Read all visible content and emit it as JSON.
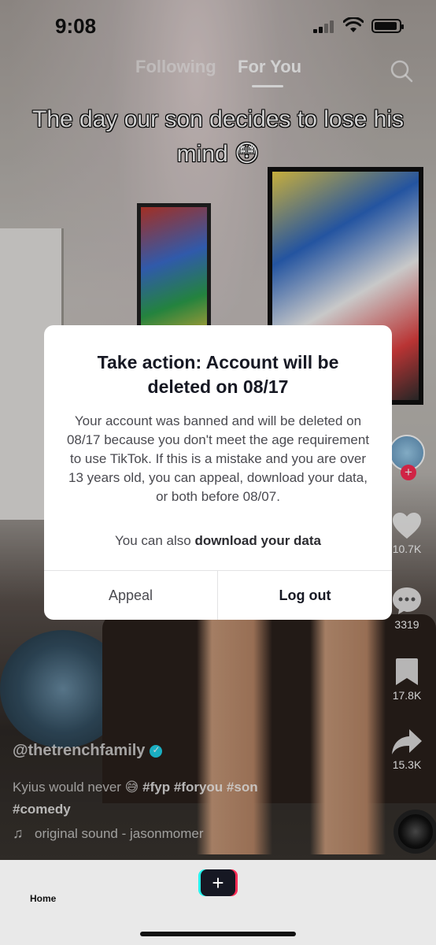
{
  "status_bar": {
    "time": "9:08"
  },
  "top_tabs": {
    "following": "Following",
    "for_you": "For You",
    "active": "For You"
  },
  "video": {
    "caption_overlay": "The day our son decides to lose his mind 😳",
    "author": "@thetrenchfamily",
    "description_text": "Kyius would never 😅",
    "hashtags": [
      "#fyp",
      "#foryou",
      "#son",
      "#comedy"
    ],
    "sound": "original sound - jasonmomer"
  },
  "side_rail": {
    "likes": "10.7K",
    "comments": "3319",
    "saves": "17.8K",
    "shares": "15.3K",
    "follow_symbol": "+"
  },
  "modal": {
    "title": "Take action: Account will be deleted on 08/17",
    "body": "Your account was banned and will be deleted on 08/17 because you don't meet the age requirement to use TikTok. If this is a mistake and you are over 13 years old, you can appeal, download your data, or both before 08/07.",
    "extra_prefix": "You can also ",
    "extra_link": "download your data",
    "appeal_label": "Appeal",
    "logout_label": "Log out"
  },
  "bottom_nav": {
    "home_label": "Home",
    "create_symbol": "+"
  },
  "colors": {
    "accent_red": "#fe2c55",
    "accent_cyan": "#25f4ee",
    "verified": "#20d5ec"
  }
}
